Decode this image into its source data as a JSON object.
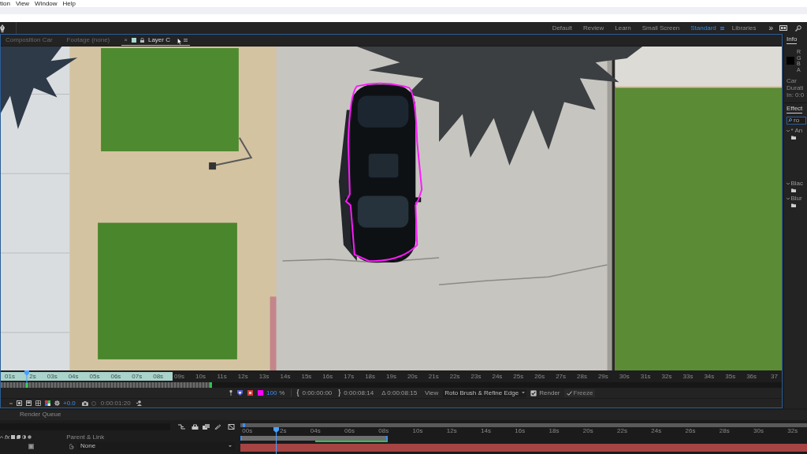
{
  "menu": [
    {
      "label": "tion"
    },
    {
      "label": "View"
    },
    {
      "label": "Window"
    },
    {
      "label": "Help"
    }
  ],
  "workspaces": {
    "items": [
      {
        "label": "Default",
        "selected": false
      },
      {
        "label": "Review",
        "selected": false
      },
      {
        "label": "Learn",
        "selected": false
      },
      {
        "label": "Small Screen",
        "selected": false
      },
      {
        "label": "Standard",
        "selected": true
      },
      {
        "label": "Libraries",
        "selected": false
      }
    ],
    "overflow": "»"
  },
  "viewer": {
    "tabs": [
      {
        "label": "Composition Car",
        "kind": "composition",
        "selected": false
      },
      {
        "label": "Footage (none)",
        "kind": "footage",
        "selected": false
      },
      {
        "label": "Layer C",
        "kind": "layer",
        "selected": true,
        "close": "×"
      }
    ]
  },
  "info_panel": {
    "tabs": [
      {
        "label": "Info",
        "selected": true
      }
    ],
    "channels": [
      "R",
      "G",
      "B",
      "A"
    ],
    "lines": [
      "Car",
      "Durati",
      "In: 0:0"
    ]
  },
  "effects_panel": {
    "tabs": [
      {
        "label": "Effect",
        "selected": true
      }
    ],
    "search": "ro",
    "items": [
      {
        "label": "* An",
        "expanded": true
      },
      {
        "label": "Blac",
        "expanded": true
      },
      {
        "label": "Blur",
        "expanded": true
      }
    ]
  },
  "layer_ruler": {
    "labels": [
      "01s",
      "2s",
      "03s",
      "04s",
      "05s",
      "06s",
      "07s",
      "08s",
      "09s",
      "10s",
      "11s",
      "12s",
      "13s",
      "14s",
      "15s",
      "16s",
      "17s",
      "18s",
      "19s",
      "20s",
      "21s",
      "22s",
      "23s",
      "24s",
      "25s",
      "26s",
      "27s",
      "28s",
      "29s",
      "30s",
      "31s",
      "32s",
      "33s",
      "34s",
      "35s",
      "36s",
      "37"
    ],
    "range": {
      "level": 0.22
    },
    "cache": {
      "level": 0.27
    },
    "playhead": {
      "level": 0.033
    }
  },
  "roto_controls": {
    "opacity": "100",
    "unit": "%",
    "in_bracket": "{",
    "in_time": "0:00:00:00",
    "out_bracket": "}",
    "out_time": "0:00:08:14",
    "duration": "Δ 0:00:08:15",
    "view_label": "View",
    "view_value": "Roto Brush & Refine Edge",
    "render": {
      "label": "Render",
      "checked": true
    },
    "freeze": {
      "label": "Freeze"
    }
  },
  "viewer_toolbar": {
    "exposure": "+0.0",
    "timecode": "0:00:01:20"
  },
  "render_queue": {
    "tabs": [
      {
        "label": "Render Queue",
        "selected": false
      }
    ]
  },
  "timeline": {
    "switches": "fx",
    "column_header": "Parent & Link",
    "layers": [
      {
        "parent": "None"
      }
    ],
    "ruler": [
      "00s",
      "2s",
      "04s",
      "06s",
      "08s",
      "10s",
      "12s",
      "14s",
      "16s",
      "18s",
      "20s",
      "22s",
      "24s",
      "26s",
      "28s",
      "30s",
      "32s"
    ],
    "playhead": {
      "level": 0.0626
    },
    "work_area": {
      "level": 0.26
    },
    "cached": {
      "level": 0.49
    }
  }
}
